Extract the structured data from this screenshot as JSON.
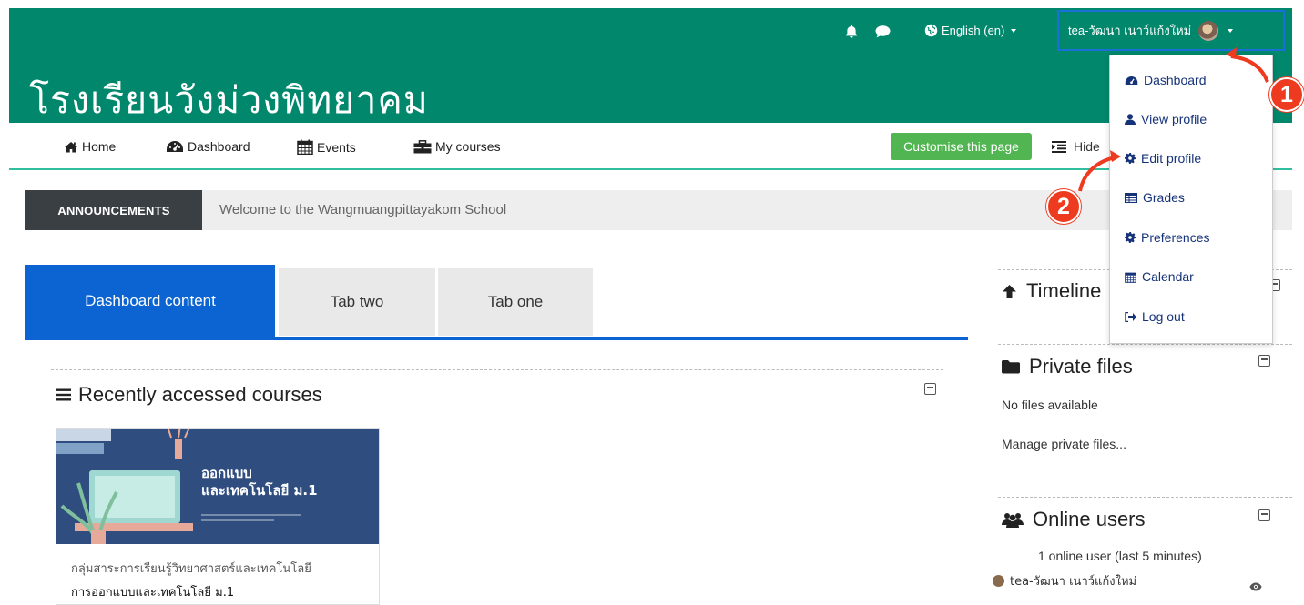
{
  "topbar": {
    "icons": [
      "bell-icon",
      "chat-icon",
      "globe-icon"
    ],
    "language": "English (en)",
    "username": "tea-วัฒนา เนาว์แก้งใหม่"
  },
  "site": {
    "title": "โรงเรียนวังม่วงพิทยาคม"
  },
  "nav": {
    "items": [
      {
        "label": "Home",
        "icon": "home-icon"
      },
      {
        "label": "Dashboard",
        "icon": "dashboard-icon"
      },
      {
        "label": "Events",
        "icon": "calendar-icon"
      },
      {
        "label": "My courses",
        "icon": "briefcase-icon"
      }
    ],
    "customise_label": "Customise this page",
    "hide_label": "Hide"
  },
  "announcement": {
    "tag": "ANNOUNCEMENTS",
    "message": "Welcome to the Wangmuangpittayakom School"
  },
  "tabs": [
    {
      "label": "Dashboard content",
      "active": true
    },
    {
      "label": "Tab two",
      "active": false
    },
    {
      "label": "Tab one",
      "active": false
    }
  ],
  "recent": {
    "title": "Recently accessed courses",
    "course": {
      "image_line1": "ออกแบบ",
      "image_line2": "และเทคโนโลยี ม.1",
      "category": "กลุ่มสาระการเรียนรู้วิทยาศาสตร์และเทคโนโลยี",
      "name": "การออกแบบและเทคโนโลยี ม.1"
    }
  },
  "blocks": {
    "timeline": {
      "title": "Timeline"
    },
    "private_files": {
      "title": "Private files",
      "empty": "No files available",
      "manage": "Manage private files..."
    },
    "online_users": {
      "title": "Online users",
      "summary": "1 online user (last 5 minutes)",
      "user": "tea-วัฒนา เนาว์แก้งใหม่"
    }
  },
  "user_menu": {
    "items": [
      {
        "label": "Dashboard",
        "icon": "dashboard-icon"
      },
      {
        "label": "View profile",
        "icon": "user-icon"
      },
      {
        "label": "Edit profile",
        "icon": "cog-icon"
      },
      {
        "label": "Grades",
        "icon": "table-icon"
      },
      {
        "label": "Preferences",
        "icon": "cog-icon"
      },
      {
        "label": "Calendar",
        "icon": "calendar-icon"
      },
      {
        "label": "Log out",
        "icon": "logout-icon"
      }
    ]
  },
  "annotations": {
    "step1": "1",
    "step2": "2",
    "color": "#ee3a1f"
  },
  "colors": {
    "brand": "#00876c",
    "tab_active": "#0b64d1",
    "customise": "#51b551",
    "link": "#16337a"
  }
}
